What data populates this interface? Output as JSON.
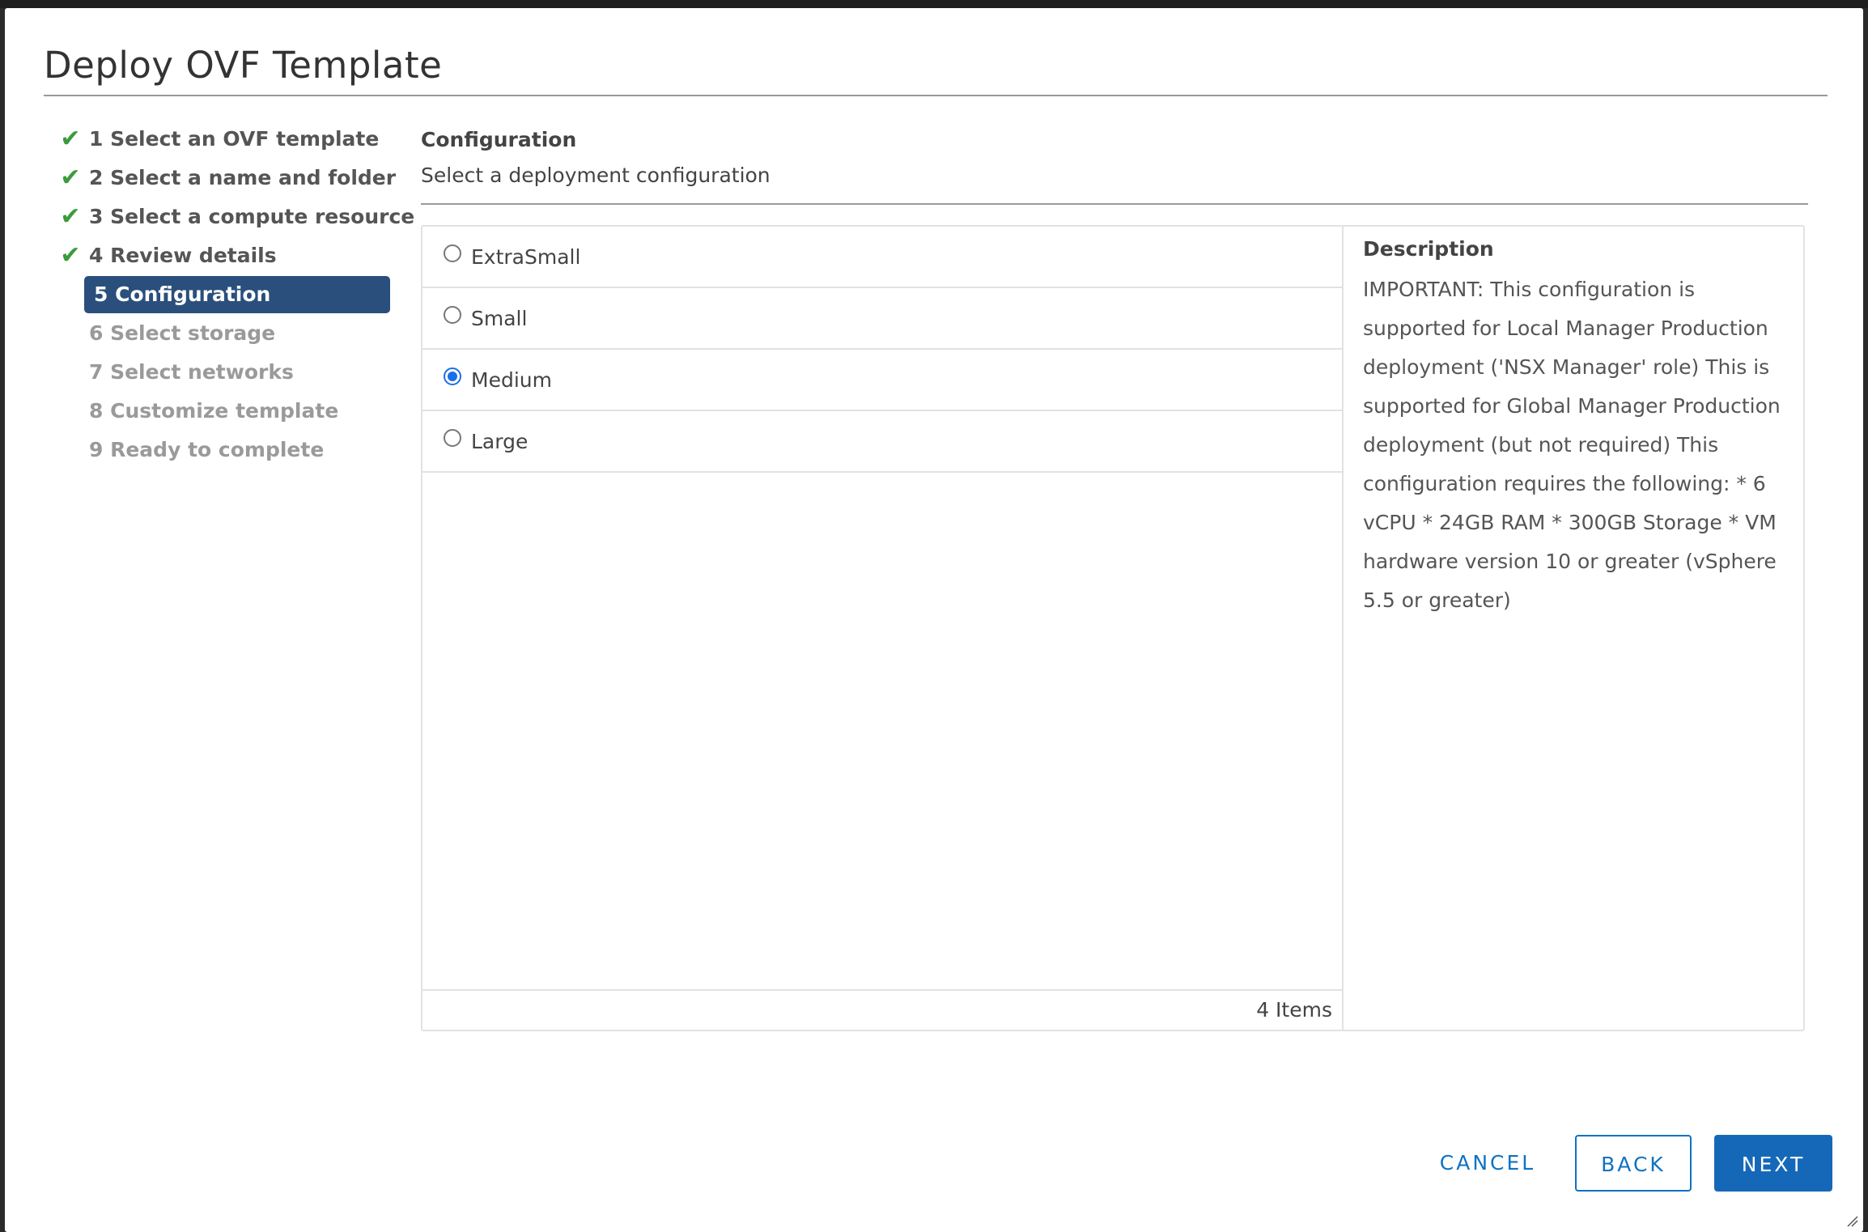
{
  "dialog": {
    "title": "Deploy OVF Template"
  },
  "steps": [
    {
      "label": "1 Select an OVF template",
      "state": "done"
    },
    {
      "label": "2 Select a name and folder",
      "state": "done"
    },
    {
      "label": "3 Select a compute resource",
      "state": "done"
    },
    {
      "label": "4 Review details",
      "state": "done"
    },
    {
      "label": "5 Configuration",
      "state": "active"
    },
    {
      "label": "6 Select storage",
      "state": "pending"
    },
    {
      "label": "7 Select networks",
      "state": "pending"
    },
    {
      "label": "8 Customize template",
      "state": "pending"
    },
    {
      "label": "9 Ready to complete",
      "state": "pending"
    }
  ],
  "section": {
    "title": "Configuration",
    "subtitle": "Select a deployment configuration"
  },
  "options": [
    {
      "label": "ExtraSmall",
      "selected": false
    },
    {
      "label": "Small",
      "selected": false
    },
    {
      "label": "Medium",
      "selected": true
    },
    {
      "label": "Large",
      "selected": false
    }
  ],
  "list_footer": "4 Items",
  "description": {
    "title": "Description",
    "body": "IMPORTANT: This configuration is supported for Local Manager Production deployment ('NSX Manager' role) This is supported for Global Manager Production deployment (but not required) This configuration requires the following: * 6 vCPU * 24GB RAM * 300GB Storage * VM hardware version 10 or greater (vSphere 5.5 or greater)"
  },
  "buttons": {
    "cancel": "CANCEL",
    "back": "BACK",
    "next": "NEXT"
  },
  "colors": {
    "active_step": "#2b4f7c",
    "check": "#3c9b3c",
    "primary": "#1568b8",
    "radio_selected": "#1a6fe8"
  }
}
